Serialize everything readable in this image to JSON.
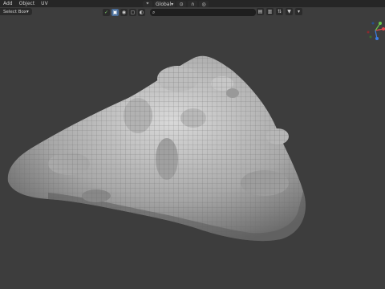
{
  "menubar": {
    "items": [
      "Add",
      "Object",
      "UV"
    ]
  },
  "header": {
    "transform_orientation": "Global"
  },
  "toolbar": {
    "search_placeholder": "",
    "mode_select": "Select Box"
  },
  "icons": {
    "orientation": "axes-icon",
    "snap": "magnet-icon",
    "proportional": "circle-icon",
    "filter": "funnel-icon"
  },
  "gizmo_colors": {
    "x": "#e5484d",
    "y": "#6ac74a",
    "z": "#3b7ee6"
  }
}
